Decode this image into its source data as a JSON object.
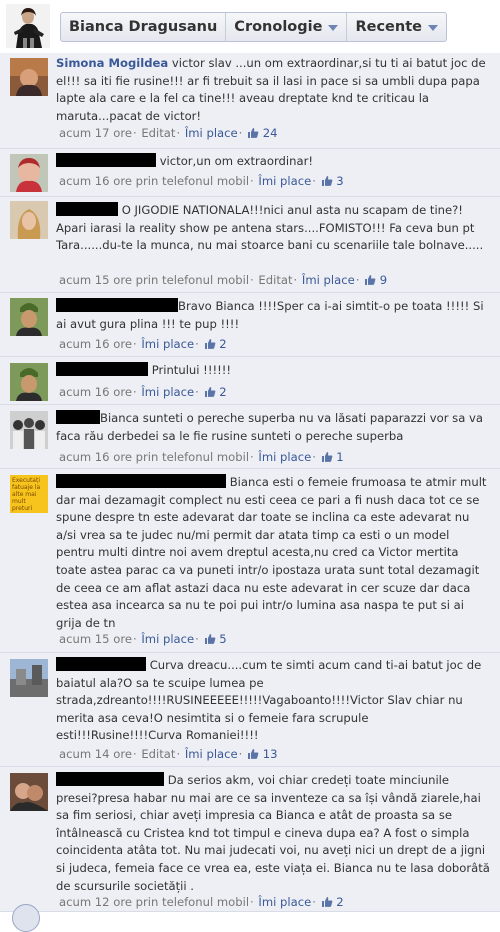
{
  "nav": {
    "profile_name": "Bianca Dragusanu",
    "timeline_label": "Cronologie",
    "recent_label": "Recente"
  },
  "comments": [
    {
      "author": "Simona Mogildea",
      "text": "victor slav ...un om extraordinar,si tu ti ai batut joc de el!!! sa iti fie rusine!!! ar fi trebuit sa il lasi in pace si sa umbli dupa papa lapte ala care e la fel ca tine!!! aveau dreptate knd te criticau la maruta...pacat de victor!",
      "time": "acum 17 ore",
      "edited": "Editat",
      "like_label": "Îmi place",
      "likes": "24"
    },
    {
      "author": "",
      "text": "victor,un om extraordinar!",
      "time": "acum 16 ore prin telefonul mobil",
      "like_label": "Îmi place",
      "likes": "3"
    },
    {
      "author": "",
      "text": "O JIGODIE NATIONALA!!!nici anul asta nu scapam de tine?! Apari iarasi la reality show pe antena stars....FOMISTO!!! Fa ceva bun pt Tara......du-te la munca, nu mai stoarce bani cu scenariile tale bolnave.....",
      "time": "acum 15 ore prin telefonul mobil",
      "edited": "Editat",
      "like_label": "Îmi place",
      "likes": "9"
    },
    {
      "author": "",
      "text": "Bravo Bianca !!!!Sper ca i-ai simtit-o pe toata !!!!! Si ai avut gura plina !!! te pup !!!!",
      "time": "acum 16 ore",
      "like_label": "Îmi place",
      "likes": "2"
    },
    {
      "author": "",
      "text": "Printului !!!!!!",
      "time": "acum 16 ore",
      "like_label": "Îmi place",
      "likes": "2"
    },
    {
      "author": "",
      "text": "Bianca sunteti o pereche superba nu va lăsati paparazzi vor sa va faca rău derbedei sa le fie rusine sunteti o pereche superba",
      "time": "acum 16 ore prin telefonul mobil",
      "like_label": "Îmi place",
      "likes": "1"
    },
    {
      "author": "",
      "text": "Bianca esti o femeie frumoasa te atmir mult dar mai dezamagit complect nu esti ceea ce pari a fi nush daca tot ce se spune despre tn este adevarat dar toate se inclina ca este adevarat nu a/si vrea sa te judec nu/mi permit dar atata timp ca esti o un model pentru multi dintre noi avem dreptul acesta,nu cred ca Victor mertita toate astea parac ca va puneti intr/o ipostaza urata sunt total dezamagit de ceea ce am aflat astazi daca nu este adevarat in cer scuze dar daca estea asa incearca sa nu te poi pui intr/o lumina asa naspa te put si ai grija de tn",
      "avatar_caption": "Executați fatuaje la alte mai mult preturi",
      "time": "acum 15 ore",
      "like_label": "Îmi place",
      "likes": "5"
    },
    {
      "author": "",
      "text": "Curva dreacu....cum te simti acum cand ti-ai batut joc de baiatul ala?O sa te scuipe lumea pe strada,zdreanto!!!!RUSINEEEEE!!!!!Vagaboanto!!!!Victor Slav chiar nu merita asa ceva!O nesimtita si o femeie fara scrupule esti!!!Rusine!!!!Curva Romaniei!!!!",
      "time": "acum 14 ore",
      "edited": "Editat",
      "like_label": "Îmi place",
      "likes": "13"
    },
    {
      "author": "",
      "text": "Da serios akm, voi chiar credeți toate minciunile presei?presa habar nu mai are ce sa inventeze ca sa își vândă ziarele,hai sa fim seriosi, chiar aveți impresia ca Bianca e atât de proasta sa se întâlnească cu Cristea knd tot timpul e cineva dupa ea? A fost o simpla coincidenta atâta tot. Nu mai judecati voi, nu aveți nici un drept de a jigni si judeca, femeia face ce vrea ea, este viața ei. Bianca nu te lasa doborâtă de scursurile societății .",
      "time": "acum 12 ore prin telefonul mobil",
      "like_label": "Îmi place",
      "likes": "2"
    }
  ]
}
